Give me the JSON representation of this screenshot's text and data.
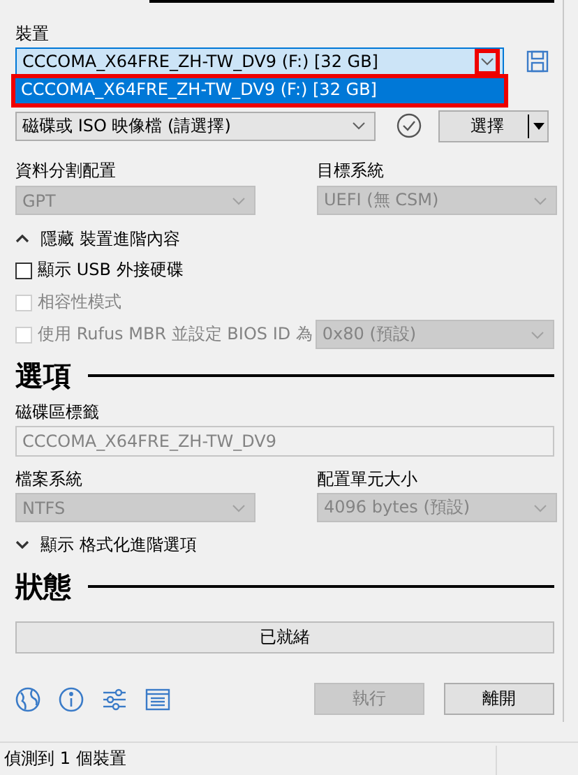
{
  "device_properties": {
    "device_label": "裝置",
    "device": {
      "value": "CCCOMA_X64FRE_ZH-TW_DV9 (F:) [32 GB]",
      "expanded": true,
      "arrow_highlighted": true,
      "options": [
        {
          "label": "CCCOMA_X64FRE_ZH-TW_DV9 (F:) [32 GB]",
          "selected": true,
          "highlighted": true
        }
      ]
    },
    "boot_selection": {
      "value": "磁碟或 ISO 映像檔 (請選擇)",
      "disabled": false
    },
    "select_button": {
      "label": "選擇",
      "disabled": false
    },
    "partition_scheme": {
      "label": "資料分割配置",
      "value": "GPT",
      "disabled": true
    },
    "target_system": {
      "label": "目標系統",
      "value": "UEFI (無 CSM)",
      "disabled": true
    },
    "advanced_toggle": {
      "label": "隱藏 裝置進階內容",
      "expanded": true
    },
    "checkboxes": [
      {
        "label": "顯示 USB 外接硬碟",
        "checked": false,
        "disabled": false
      },
      {
        "label": "相容性模式",
        "checked": false,
        "disabled": true
      },
      {
        "label": "使用 Rufus MBR 並設定 BIOS ID 為",
        "checked": false,
        "disabled": true
      }
    ],
    "bios_id": {
      "value": "0x80 (預設)",
      "disabled": true
    }
  },
  "format_options": {
    "heading": "選項",
    "volume_label": {
      "label": "磁碟區標籤",
      "value": "CCCOMA_X64FRE_ZH-TW_DV9",
      "disabled": true
    },
    "file_system": {
      "label": "檔案系統",
      "value": "NTFS",
      "disabled": true
    },
    "cluster_size": {
      "label": "配置單元大小",
      "value": "4096 bytes (預設)",
      "disabled": true
    },
    "advanced_toggle": {
      "label": "顯示 格式化進階選項",
      "expanded": false
    }
  },
  "status": {
    "heading": "狀態",
    "progress": {
      "text": "已就緒",
      "level": 0
    }
  },
  "buttons": [
    {
      "label": "執行",
      "disabled": true
    },
    {
      "label": "離開",
      "disabled": false
    }
  ],
  "status_bar": {
    "text": "偵測到 1 個裝置"
  }
}
